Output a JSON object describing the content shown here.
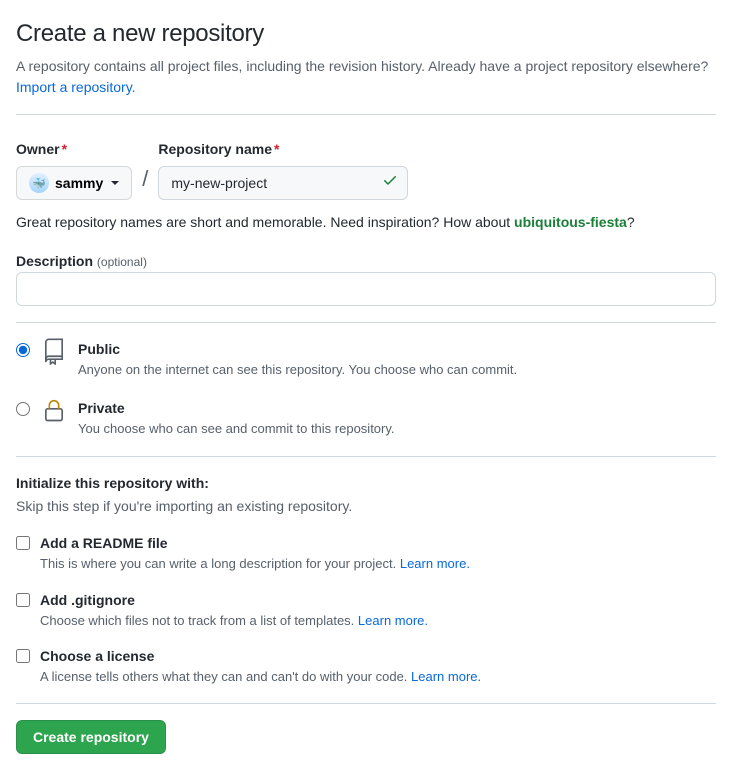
{
  "heading": "Create a new repository",
  "subtitle_prefix": "A repository contains all project files, including the revision history. Already have a project repository elsewhere? ",
  "import_link": "Import a repository.",
  "owner": {
    "label": "Owner",
    "name": "sammy"
  },
  "repo": {
    "label": "Repository name",
    "value": "my-new-project"
  },
  "slash": "/",
  "hint_prefix": "Great repository names are short and memorable. Need inspiration? How about ",
  "suggestion": "ubiquitous-fiesta",
  "hint_suffix": "?",
  "description": {
    "label": "Description",
    "optional": "(optional)",
    "value": ""
  },
  "visibility": {
    "public": {
      "title": "Public",
      "desc": "Anyone on the internet can see this repository. You choose who can commit."
    },
    "private": {
      "title": "Private",
      "desc": "You choose who can see and commit to this repository."
    },
    "selected": "public"
  },
  "init": {
    "title": "Initialize this repository with:",
    "sub": "Skip this step if you're importing an existing repository.",
    "readme": {
      "title": "Add a README file",
      "desc": "This is where you can write a long description for your project. ",
      "link": "Learn more."
    },
    "gitignore": {
      "title": "Add .gitignore",
      "desc": "Choose which files not to track from a list of templates. ",
      "link": "Learn more."
    },
    "license": {
      "title": "Choose a license",
      "desc": "A license tells others what they can and can't do with your code. ",
      "link": "Learn more."
    }
  },
  "submit": "Create repository"
}
